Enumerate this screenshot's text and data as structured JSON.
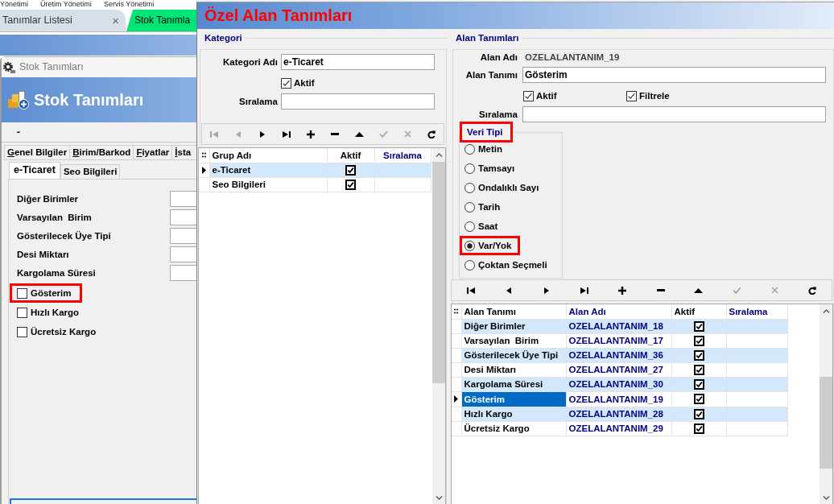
{
  "menu_bar": [
    "Yönetimi",
    "Üretim Yönetimi",
    "Servis Yönetimi"
  ],
  "document_tabs": [
    {
      "label": "Tanımlar Listesi",
      "close": "×",
      "selected": false
    },
    {
      "label": "Stok Tanımla",
      "selected": true
    }
  ],
  "stok_window": {
    "title": "Stok Tanımları",
    "header": "Stok Tanımları",
    "toolbar_text": "-",
    "tabs": [
      {
        "label": "Genel Bilgiler",
        "selected": false
      },
      {
        "label": "Birim/Barkod",
        "selected": false
      },
      {
        "label": "Fiyatlar",
        "selected": false
      },
      {
        "label": "İsta",
        "selected": false
      }
    ],
    "subtabs": [
      {
        "label": "e-Ticaret",
        "selected": true
      },
      {
        "label": "Seo Bilgileri",
        "selected": false
      }
    ],
    "fields": [
      {
        "label": "Diğer Birimler"
      },
      {
        "label": "Varsayılan  Birim"
      },
      {
        "label": "Gösterilecek Üye Tipi"
      },
      {
        "label": "Desi Miktarı"
      },
      {
        "label": "Kargolama Süresi"
      }
    ],
    "checkboxes": [
      {
        "label": "Gösterim",
        "checked": false,
        "highlighted": true
      },
      {
        "label": "Hızlı Kargo",
        "checked": false,
        "highlighted": false
      },
      {
        "label": "Ücretsiz Kargo",
        "checked": false,
        "highlighted": false
      }
    ]
  },
  "dialog": {
    "title": "Özel Alan Tanımları",
    "kategori": {
      "legend": "Kategori",
      "name_label": "Kategori Adı",
      "name_value": "e-Ticaret",
      "active": {
        "label": "Aktif",
        "checked": true
      },
      "order_label": "Sıralama",
      "toolbar": [
        {
          "kind": "first",
          "disabled": true
        },
        {
          "kind": "prior",
          "disabled": true
        },
        {
          "kind": "next",
          "disabled": false
        },
        {
          "kind": "last",
          "disabled": false
        },
        {
          "kind": "insert",
          "disabled": false
        },
        {
          "kind": "delete",
          "disabled": false
        },
        {
          "kind": "edit",
          "disabled": false
        },
        {
          "kind": "post",
          "disabled": true
        },
        {
          "kind": "cancel",
          "disabled": true
        },
        {
          "kind": "refresh",
          "disabled": false
        }
      ],
      "grid": {
        "focused": false,
        "columns": [
          {
            "label": "Grup Adı",
            "kind": "label",
            "color": "#000000"
          },
          {
            "label": "Aktif",
            "kind": "check",
            "color": "#000000"
          },
          {
            "label": "Sıralama",
            "kind": "order",
            "color": "#000080"
          }
        ],
        "rows": [
          {
            "label": "e-Ticaret",
            "checked": true,
            "selected": true
          },
          {
            "label": "Seo Bilgileri",
            "checked": true,
            "selected": false
          }
        ]
      }
    },
    "alan": {
      "legend": "Alan Tanımları",
      "code_label": "Alan Adı",
      "code_value": "OZELALANTANIM_19",
      "name_label": "Alan Tanımı",
      "name_value": "Gösterim",
      "checks": [
        {
          "label": "Aktif",
          "checked": true
        },
        {
          "label": "Filtrele",
          "checked": true
        }
      ],
      "order_label": "Sıralama",
      "data_type": {
        "legend": "Veri Tipi",
        "highlighted": true,
        "options": [
          {
            "label": "Metin",
            "selected": false,
            "highlighted": false
          },
          {
            "label": "Tamsayı",
            "selected": false,
            "highlighted": false
          },
          {
            "label": "Ondalıklı Sayı",
            "selected": false,
            "highlighted": false
          },
          {
            "label": "Tarih",
            "selected": false,
            "highlighted": false
          },
          {
            "label": "Saat",
            "selected": false,
            "highlighted": false
          },
          {
            "label": "Var/Yok",
            "selected": true,
            "highlighted": true
          },
          {
            "label": "Çoktan Seçmeli",
            "selected": false,
            "highlighted": false
          }
        ]
      },
      "toolbar": [
        {
          "kind": "first",
          "disabled": false
        },
        {
          "kind": "prior",
          "disabled": false
        },
        {
          "kind": "next",
          "disabled": false
        },
        {
          "kind": "last",
          "disabled": false
        },
        {
          "kind": "insert",
          "disabled": false
        },
        {
          "kind": "delete",
          "disabled": false
        },
        {
          "kind": "edit",
          "disabled": false
        },
        {
          "kind": "post",
          "disabled": true
        },
        {
          "kind": "cancel",
          "disabled": true
        },
        {
          "kind": "refresh",
          "disabled": false
        }
      ],
      "grid": {
        "focused": true,
        "columns": [
          {
            "label": "Alan Tanımı",
            "kind": "label",
            "color": "#000000"
          },
          {
            "label": "Alan Adı",
            "kind": "code",
            "color": "#000080"
          },
          {
            "label": "Aktif",
            "kind": "check",
            "color": "#000000"
          },
          {
            "label": "Sıralama",
            "kind": "order",
            "color": "#000080"
          }
        ],
        "rows": [
          {
            "label": "Diğer Birimler",
            "code": "OZELALANTANIM_18",
            "checked": true,
            "selected": false
          },
          {
            "label": "Varsayılan  Birim",
            "code": "OZELALANTANIM_17",
            "checked": true,
            "selected": false
          },
          {
            "label": "Gösterilecek Üye Tipi",
            "code": "OZELALANTANIM_36",
            "checked": true,
            "selected": false
          },
          {
            "label": "Desi Miktarı",
            "code": "OZELALANTANIM_27",
            "checked": true,
            "selected": false
          },
          {
            "label": "Kargolama Süresi",
            "code": "OZELALANTANIM_30",
            "checked": true,
            "selected": false
          },
          {
            "label": "Gösterim",
            "code": "OZELALANTANIM_19",
            "checked": true,
            "selected": true
          },
          {
            "label": "Hızlı Kargo",
            "code": "OZELALANTANIM_28",
            "checked": true,
            "selected": false
          },
          {
            "label": "Ücretsiz Kargo",
            "code": "OZELALANTANIM_29",
            "checked": true,
            "selected": false
          }
        ]
      }
    }
  }
}
